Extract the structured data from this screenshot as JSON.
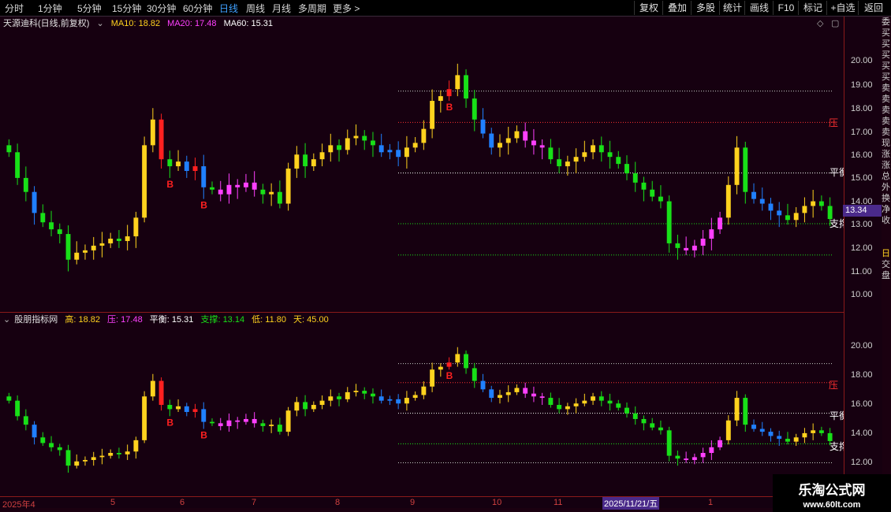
{
  "toolbar": {
    "left": [
      "分时",
      "1分钟",
      "5分钟",
      "15分钟",
      "30分钟",
      "60分钟",
      "日线",
      "周线",
      "月线",
      "多周期",
      "更多 >"
    ],
    "active": "日线",
    "right": [
      "复权",
      "叠加",
      "多股",
      "统计",
      "画线",
      "F10",
      "标记",
      "+自选",
      "返回"
    ]
  },
  "upper": {
    "title": "天源迪科(日线,前复权)",
    "ma10": "MA10: 18.82",
    "ma20": "MA20: 17.48",
    "ma60": "MA60: 15.31",
    "ticks": [
      "20.00",
      "19.00",
      "18.00",
      "17.00",
      "16.00",
      "15.00",
      "14.00",
      "13.00",
      "12.00",
      "11.00",
      "10.00"
    ],
    "price_tag": "13.34",
    "label_ya": "压",
    "label_pingheng": "平衡",
    "label_zhicheng": "支撑",
    "b_label": "B",
    "right_strip": [
      "委",
      "买",
      "买",
      "买",
      "买",
      "买",
      "卖",
      "卖",
      "卖",
      "卖",
      "卖",
      "现",
      "涨",
      "涨",
      "总",
      "外",
      "换",
      "净",
      "收"
    ]
  },
  "lower": {
    "title": "股朋指标网",
    "gao": "高: 18.82",
    "ya": "压: 17.48",
    "pingheng": "平衡: 15.31",
    "zhicheng": "支撑: 13.14",
    "di": "低: 11.80",
    "tian": "天: 45.00",
    "ticks": [
      "20.00",
      "18.00",
      "16.00",
      "14.00",
      "12.00"
    ],
    "label_ya": "压",
    "label_pingheng": "平衡",
    "label_zhicheng": "支撑",
    "b_label": "B",
    "right_strip": [
      "日",
      "交",
      "盘"
    ]
  },
  "dates": [
    "2025年4",
    "5",
    "6",
    "7",
    "8",
    "9",
    "10",
    "11",
    "1"
  ],
  "date_highlight": "2025/11/21/五",
  "watermark": {
    "line1": "乐淘公式网",
    "line2": "www.60lt.com"
  },
  "colors": {
    "up": "#ffd21e",
    "down": "#18e018",
    "blue": "#2080ff",
    "pink": "#ff40ff",
    "red": "#ff2020"
  },
  "chart_data": {
    "type": "candlestick",
    "title": "天源迪科(日线,前复权)",
    "ma": {
      "MA10": 18.82,
      "MA20": 17.48,
      "MA60": 15.31
    },
    "levels": {
      "high": 18.82,
      "pressure": 17.48,
      "balance": 15.31,
      "support": 13.14,
      "low": 11.8
    },
    "last_price": 13.34,
    "ylim": [
      9.6,
      21.2
    ],
    "close": [
      16.2,
      15.1,
      14.5,
      13.6,
      13.2,
      12.9,
      12.7,
      11.6,
      11.9,
      12.0,
      12.2,
      12.3,
      12.5,
      12.4,
      12.6,
      13.4,
      16.5,
      17.6,
      15.9,
      15.6,
      15.8,
      15.4,
      15.6,
      14.7,
      14.6,
      14.4,
      14.8,
      14.7,
      14.9,
      14.6,
      14.4,
      14.5,
      14.0,
      15.5,
      16.1,
      15.6,
      15.9,
      16.2,
      16.5,
      16.3,
      16.8,
      16.9,
      16.7,
      16.5,
      16.2,
      16.3,
      16.0,
      16.4,
      16.6,
      17.2,
      18.4,
      18.6,
      18.9,
      19.5,
      18.5,
      17.6,
      17.0,
      16.4,
      16.6,
      16.8,
      17.1,
      16.7,
      16.5,
      16.4,
      15.9,
      15.6,
      15.8,
      16.0,
      16.2,
      16.5,
      16.2,
      16.0,
      15.7,
      15.3,
      14.9,
      14.6,
      14.3,
      14.1,
      12.3,
      12.1,
      12.0,
      12.2,
      12.5,
      12.9,
      13.4,
      14.8,
      16.4,
      14.5,
      14.2,
      14.0,
      13.7,
      13.5,
      13.3,
      13.6,
      13.9,
      14.1,
      13.9,
      13.34
    ]
  }
}
